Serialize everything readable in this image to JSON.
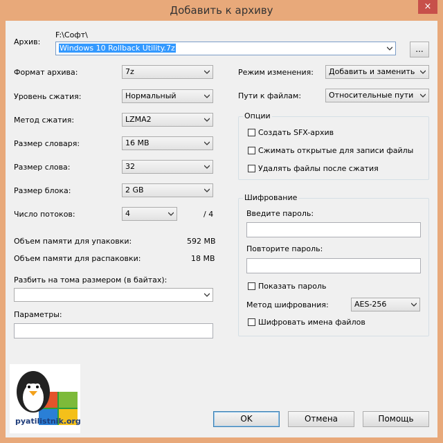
{
  "window": {
    "title": "Добавить к архиву",
    "close_glyph": "×"
  },
  "archive": {
    "label": "Архив:",
    "path": "F:\\Софт\\",
    "filename": "Windows 10 Rollback Utility.7z",
    "browse_label": "..."
  },
  "left": {
    "format_label": "Формат архива:",
    "format_value": "7z",
    "level_label": "Уровень сжатия:",
    "level_value": "Нормальный",
    "method_label": "Метод сжатия:",
    "method_value": "LZMA2",
    "dict_label": "Размер словаря:",
    "dict_value": "16 MB",
    "word_label": "Размер слова:",
    "word_value": "32",
    "block_label": "Размер блока:",
    "block_value": "2 GB",
    "threads_label": "Число потоков:",
    "threads_value": "4",
    "threads_total": "/ 4",
    "mem_pack_label": "Объем памяти для упаковки:",
    "mem_pack_value": "592 MB",
    "mem_unpack_label": "Объем памяти для распаковки:",
    "mem_unpack_value": "18 MB",
    "split_label": "Разбить на тома размером (в байтах):",
    "split_value": "",
    "params_label": "Параметры:",
    "params_value": ""
  },
  "right": {
    "update_label": "Режим изменения:",
    "update_value": "Добавить и заменить",
    "paths_label": "Пути к файлам:",
    "paths_value": "Относительные пути",
    "options_title": "Опции",
    "opt_sfx": "Создать SFX-архив",
    "opt_shared": "Сжимать открытые для записи файлы",
    "opt_delete": "Удалять файлы после сжатия",
    "enc_title": "Шифрование",
    "enc_password_label": "Введите пароль:",
    "enc_repeat_label": "Повторите пароль:",
    "enc_show_label": "Показать пароль",
    "enc_method_label": "Метод шифрования:",
    "enc_method_value": "AES-256",
    "enc_names_label": "Шифровать имена файлов"
  },
  "buttons": {
    "ok": "OK",
    "cancel": "Отмена",
    "help": "Помощь"
  },
  "logo": {
    "text": "pyatilistnik.org"
  },
  "colors": {
    "frame": "#e8a97a",
    "close": "#c7504a",
    "selection": "#3399ff"
  }
}
